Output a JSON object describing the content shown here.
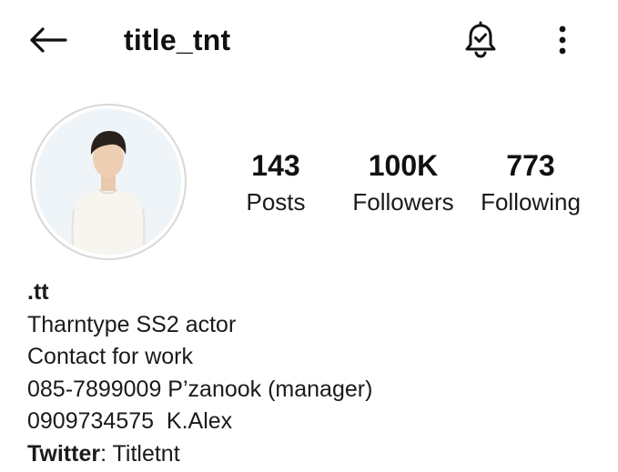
{
  "header": {
    "username": "title_tnt",
    "back_icon": "arrow-left-icon",
    "bell_icon": "bell-check-icon",
    "more_icon": "more-vertical-icon"
  },
  "profile": {
    "avatar": "profile-photo"
  },
  "stats": {
    "posts": {
      "value": "143",
      "label": "Posts"
    },
    "followers": {
      "value": "100K",
      "label": "Followers"
    },
    "following": {
      "value": "773",
      "label": "Following"
    }
  },
  "bio": {
    "name": ".tt",
    "lines": [
      "Tharntype SS2 actor",
      "Contact for work",
      "085-7899009 P’zanook (manager)",
      "0909734575  K.Alex"
    ],
    "twitter_label": "Twitter",
    "twitter_sep": ": ",
    "twitter_value": "Titletnt"
  },
  "colors": {
    "text": "#111111",
    "avatar_ring": "#d8d8d8",
    "background": "#ffffff"
  }
}
